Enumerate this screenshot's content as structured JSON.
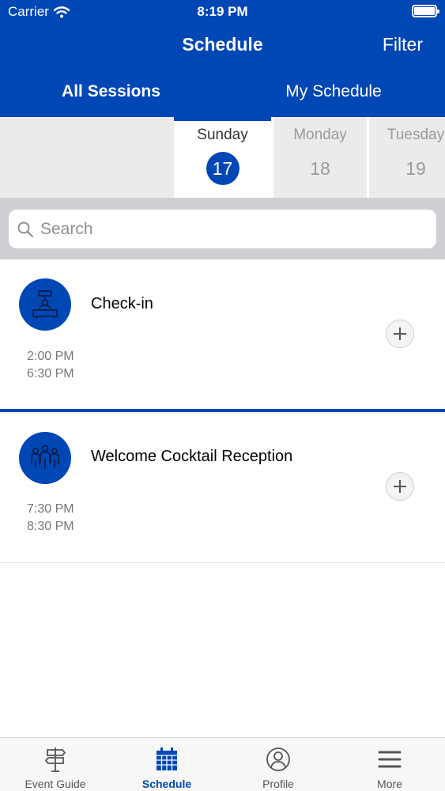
{
  "status_bar": {
    "carrier": "Carrier",
    "time": "8:19 PM"
  },
  "nav": {
    "title": "Schedule",
    "filter_label": "Filter"
  },
  "segments": {
    "all_sessions": "All Sessions",
    "my_schedule": "My Schedule",
    "selected": "All Sessions"
  },
  "dates": [
    {
      "day": "Sunday",
      "number": "17",
      "selected": true
    },
    {
      "day": "Monday",
      "number": "18",
      "selected": false
    },
    {
      "day": "Tuesday",
      "number": "19",
      "selected": false
    }
  ],
  "search": {
    "placeholder": "Search",
    "value": ""
  },
  "sessions": [
    {
      "title": "Check-in",
      "start": "2:00 PM",
      "end": "6:30 PM",
      "icon": "check-in-desk-icon"
    },
    {
      "title": "Welcome Cocktail Reception",
      "start": "7:30 PM",
      "end": "8:30 PM",
      "icon": "group-people-icon"
    }
  ],
  "tabbar": {
    "event_guide": "Event Guide",
    "schedule": "Schedule",
    "profile": "Profile",
    "more": "More",
    "active": "Schedule"
  },
  "colors": {
    "brand_blue": "#0047b6",
    "date_strip_bg": "#ebebeb",
    "search_zone_bg": "#cfcfd3"
  }
}
